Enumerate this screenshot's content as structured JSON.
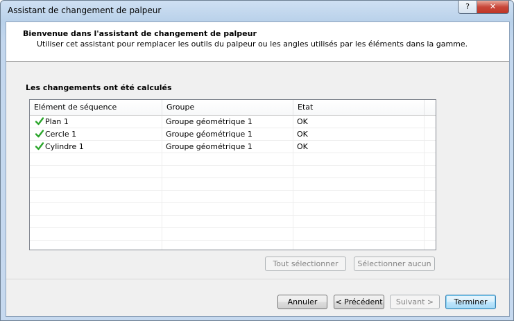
{
  "window": {
    "title": "Assistant de changement de palpeur",
    "help_label": "?",
    "close_label": "✕"
  },
  "header": {
    "title": "Bienvenue dans l'assistant de changement de palpeur",
    "subtitle": "Utiliser cet assistant pour remplacer les outils du palpeur ou les angles utilisés par les éléments dans la gamme."
  },
  "section": {
    "label": "Les changements ont été calculés"
  },
  "table": {
    "columns": [
      "Elément de séquence",
      "Groupe",
      "Etat"
    ],
    "rows": [
      {
        "element": "Plan 1",
        "groupe": "Groupe géométrique 1",
        "etat": "OK",
        "icon": "check-icon"
      },
      {
        "element": "Cercle 1",
        "groupe": "Groupe géométrique 1",
        "etat": "OK",
        "icon": "check-icon"
      },
      {
        "element": "Cylindre 1",
        "groupe": "Groupe géométrique 1",
        "etat": "OK",
        "icon": "check-icon"
      }
    ]
  },
  "selection_buttons": {
    "select_all": "Tout sélectionner",
    "select_none": "Sélectionner aucun"
  },
  "nav_buttons": {
    "cancel": "Annuler",
    "previous": "< Précédent",
    "next": "Suivant >",
    "finish": "Terminer"
  },
  "colors": {
    "check": "#2aa52a",
    "default_button_border": "#3c7fb1"
  }
}
